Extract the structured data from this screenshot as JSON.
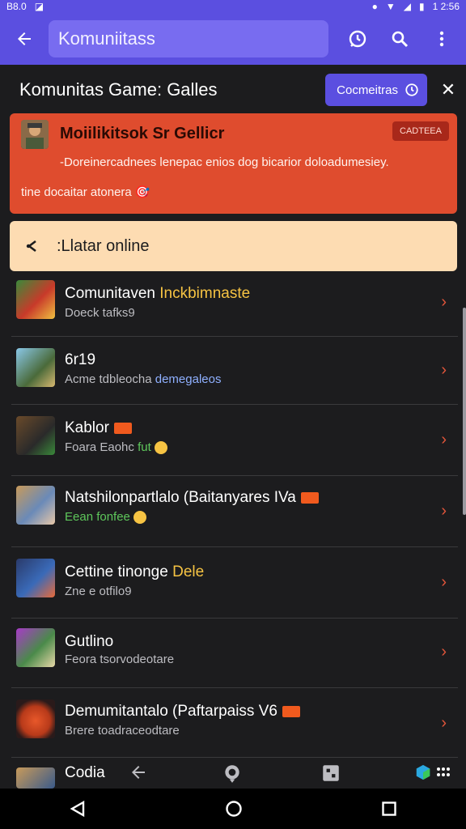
{
  "status": {
    "time_left": "B8.0",
    "time_right": "1 2:56"
  },
  "appbar": {
    "search_text": "Komuniitass"
  },
  "header": {
    "title": "Komunitas Game: Galles",
    "pill_label": "Cocmeitras"
  },
  "banner": {
    "title": "Moiilikitsok Sr Gellicr",
    "badge": "CADTEEA",
    "description": "-Doreinercadnees lenepac enios dog bicarior doloadumesiey.",
    "footer": "tine docaitar atonera 🎯"
  },
  "online": {
    "label": ":Llatar online"
  },
  "rows": [
    {
      "title": "Comunitaven ",
      "title_hl": "Inckbimnaste",
      "sub": "Doeck tafks9",
      "sub_extra": "",
      "tag": false
    },
    {
      "title": "6r19",
      "title_hl": "",
      "sub": "Acme tdbleocha ",
      "sub_extra": "demegaleos",
      "tag": false
    },
    {
      "title": "Kablor",
      "title_hl": "",
      "sub": "Foara Eaohc ",
      "sub_extra": "fut",
      "tag": true
    },
    {
      "title": "Natshilonpartlalo (Baitanyares IVa",
      "title_hl": "",
      "sub": "Eean fonfee",
      "sub_extra": "",
      "tag": true
    },
    {
      "title": "Cettine tinonge ",
      "title_hl": "Dele",
      "sub": "Zne e otfilo9",
      "sub_extra": "",
      "tag": false
    },
    {
      "title": "Gutlino",
      "title_hl": "",
      "sub": "Feora tsorvodeotare",
      "sub_extra": "",
      "tag": false
    },
    {
      "title": "Demumitantalo (Paftarpaiss V6",
      "title_hl": "",
      "sub": "Brere toadraceodtare",
      "sub_extra": "",
      "tag": true
    }
  ],
  "last_row": {
    "title": "Codia"
  },
  "colors": {
    "accent": "#5b4fe0",
    "banner": "#df4c2e",
    "online_bg": "#fddcb2",
    "highlight": "#f6c343"
  }
}
